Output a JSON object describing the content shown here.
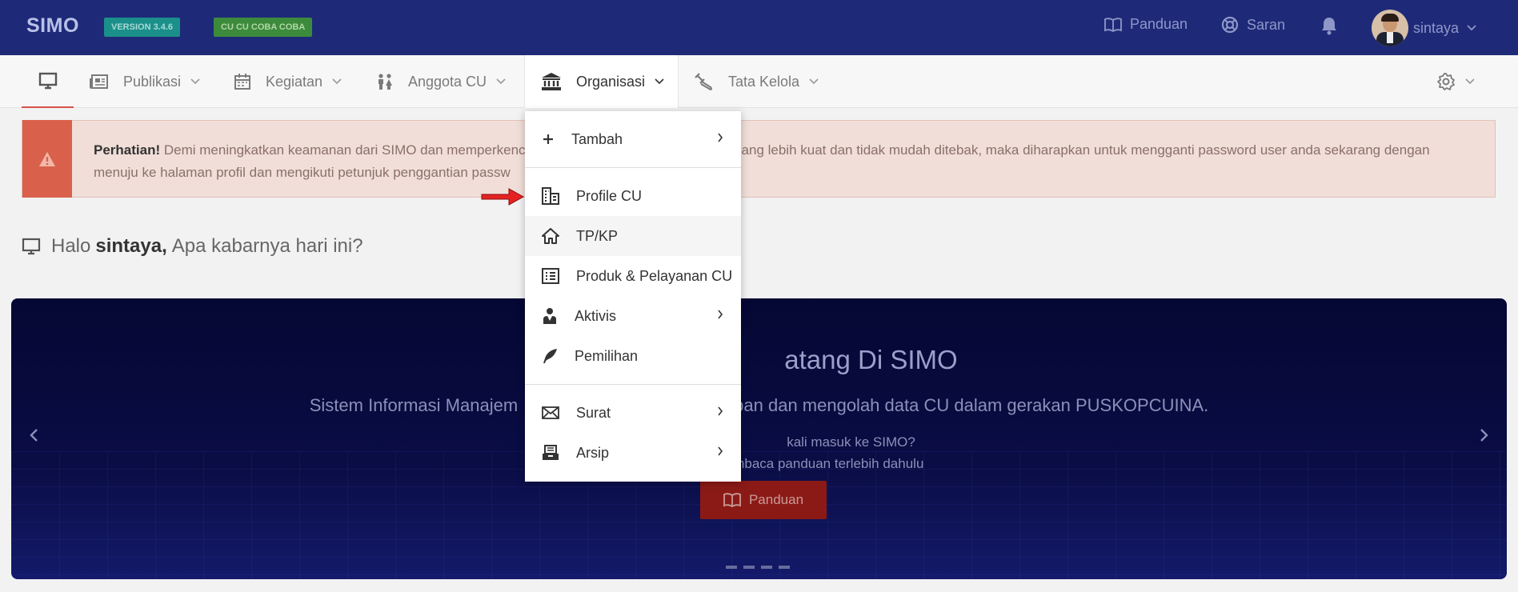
{
  "topbar": {
    "brand": "SIMO",
    "version_badge": "VERSION 3.4.6",
    "cu_badge": "CU CU COBA COBA",
    "panduan": "Panduan",
    "saran": "Saran",
    "username": "sintaya"
  },
  "subnav": {
    "publikasi": "Publikasi",
    "kegiatan": "Kegiatan",
    "anggota": "Anggota CU",
    "organisasi": "Organisasi",
    "tata_kelola": "Tata Kelola"
  },
  "alert": {
    "strong": "Perhatian!",
    "line1": "Demi meningkatkan keamanan dari SIMO dan memperkenc",
    "line1_rest": "ang lebih kuat dan tidak mudah ditebak, maka diharapkan untuk mengganti password user anda sekarang dengan",
    "line2": "menuju ke halaman profil dan mengikuti petunjuk penggantian passw"
  },
  "greeting": {
    "prefix": "Halo",
    "name": "sintaya,",
    "suffix": "Apa kabarnya hari ini?"
  },
  "hero": {
    "title": "atang Di SIMO",
    "subtitle_left": "Sistem Informasi Manajem",
    "subtitle_right": "pan dan mengolah data CU dalam gerakan PUSKOPCUINA.",
    "line1": "kali masuk ke SIMO?",
    "line2": "membaca panduan terlebih dahulu",
    "button": "Panduan"
  },
  "dropdown": {
    "items": [
      {
        "label": "Tambah",
        "icon": "plus-icon",
        "submenu": true
      },
      {
        "label": "Profile CU",
        "icon": "building-icon",
        "submenu": false
      },
      {
        "label": "TP/KP",
        "icon": "home-icon",
        "submenu": false
      },
      {
        "label": "Produk & Pelayanan CU",
        "icon": "list-icon",
        "submenu": false
      },
      {
        "label": "Aktivis",
        "icon": "user-tie-icon",
        "submenu": true
      },
      {
        "label": "Pemilihan",
        "icon": "feather-icon",
        "submenu": false
      },
      {
        "label": "Surat",
        "icon": "envelope-icon",
        "submenu": true
      },
      {
        "label": "Arsip",
        "icon": "archive-icon",
        "submenu": true
      }
    ]
  },
  "colors": {
    "topbar": "#1e2a78",
    "accent_red": "#d8534a",
    "alert_bg": "#f1ded8",
    "hero_bg": "#050733"
  }
}
